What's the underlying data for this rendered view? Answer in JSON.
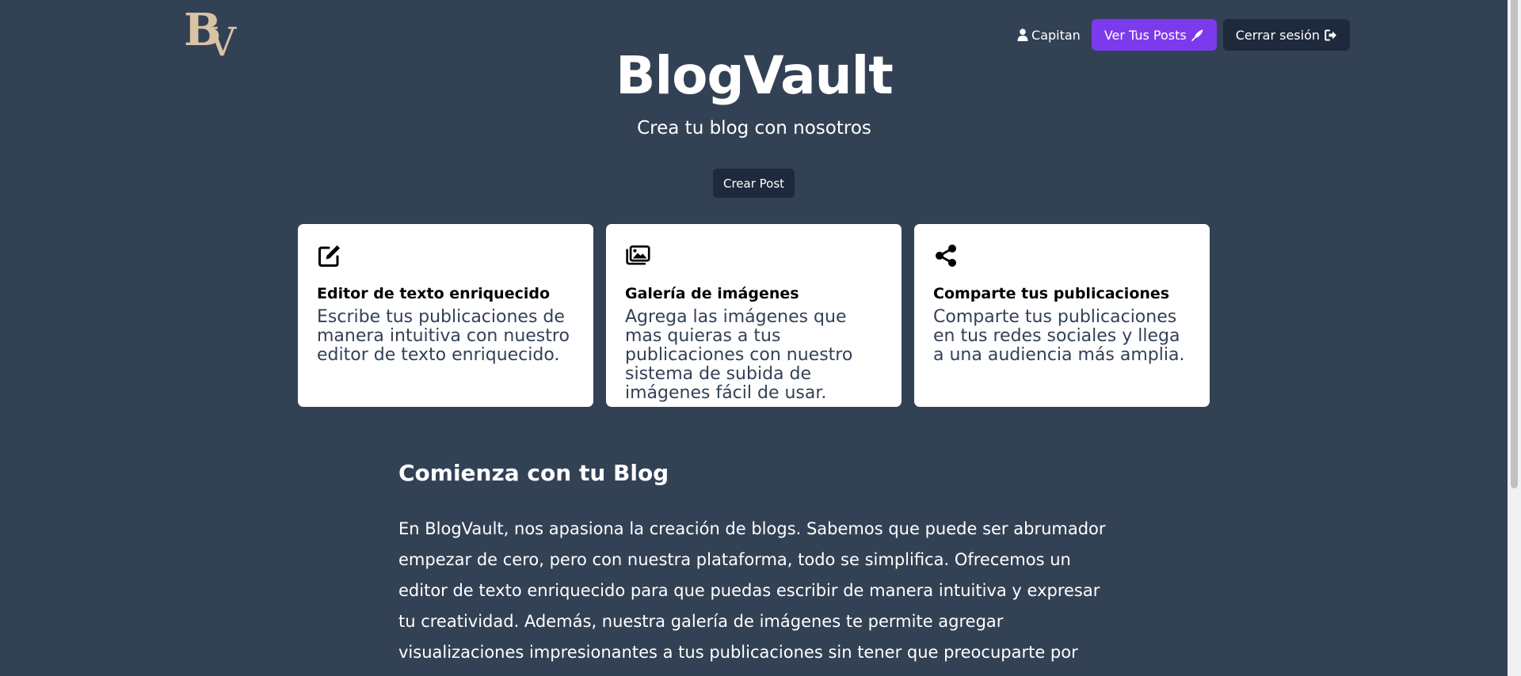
{
  "logo": {
    "text": "BV",
    "b": "B",
    "v": "V",
    "color": "#d8c3a5"
  },
  "header": {
    "user_icon": "user-icon",
    "username": "Capitan",
    "posts_button": "Ver Tus Posts",
    "posts_icon": "pen-icon",
    "logout_button": "Cerrar sesión",
    "logout_icon": "sign-out-icon"
  },
  "hero": {
    "title": "BlogVault",
    "subtitle": "Crea tu blog con nosotros",
    "create_button": "Crear Post"
  },
  "features": [
    {
      "icon": "edit-icon",
      "title": "Editor de texto enriquecido",
      "text": "Escribe tus publicaciones de manera intuitiva con nuestro editor de texto enriquecido."
    },
    {
      "icon": "images-icon",
      "title": "Galería de imágenes",
      "text": "Agrega las imágenes que mas quieras a tus publicaciones con nuestro sistema de subida de imágenes fácil de usar."
    },
    {
      "icon": "share-icon",
      "title": "Comparte tus publicaciones",
      "text": "Comparte tus publicaciones en tus redes sociales y llega a una audiencia más amplia."
    }
  ],
  "intro": {
    "title": "Comienza con tu Blog",
    "lines": [
      "En BlogVault, nos apasiona la creación de blogs. Sabemos que puede ser abrumador",
      "empezar de cero, pero con nuestra plataforma, todo se simplifica. Ofrecemos un",
      "editor de texto enriquecido para que puedas escribir de manera intuitiva y expresar",
      "tu creatividad. Además, nuestra galería de imágenes te permite agregar",
      "visualizaciones impresionantes a tus publicaciones sin tener que preocuparte por"
    ]
  },
  "colors": {
    "background": "#334155",
    "accent": "#7c3aed",
    "dark_button": "#1e293b",
    "logo": "#d8c3a5"
  }
}
